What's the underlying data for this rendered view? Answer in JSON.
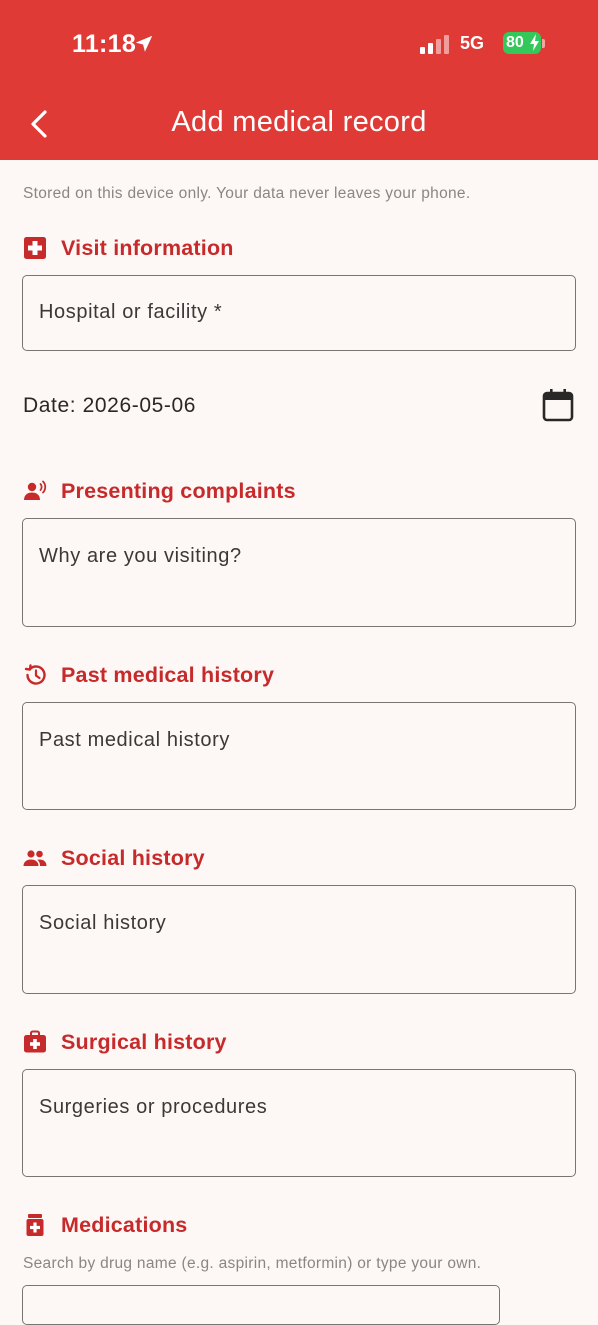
{
  "status": {
    "time": "11:18",
    "network": "5G",
    "battery": "80"
  },
  "header": {
    "title": "Add medical record"
  },
  "notice": "Stored on this device only. Your data never leaves your phone.",
  "visit": {
    "title": "Visit information",
    "facility_placeholder": "Hospital or facility *",
    "date_label": "Date: 2026-05-06"
  },
  "complaints": {
    "title": "Presenting complaints",
    "placeholder": "Why are you visiting?"
  },
  "past_history": {
    "title": "Past medical history",
    "placeholder": "Past medical history"
  },
  "social_history": {
    "title": "Social history",
    "placeholder": "Social history"
  },
  "surgical_history": {
    "title": "Surgical history",
    "placeholder": "Surgeries or procedures"
  },
  "medications": {
    "title": "Medications",
    "hint": "Search by drug name (e.g. aspirin, metformin) or type your own."
  },
  "colors": {
    "primary": "#e03a36",
    "section_title": "#c62a2a",
    "background": "#fdf8f6",
    "battery": "#34c759"
  }
}
